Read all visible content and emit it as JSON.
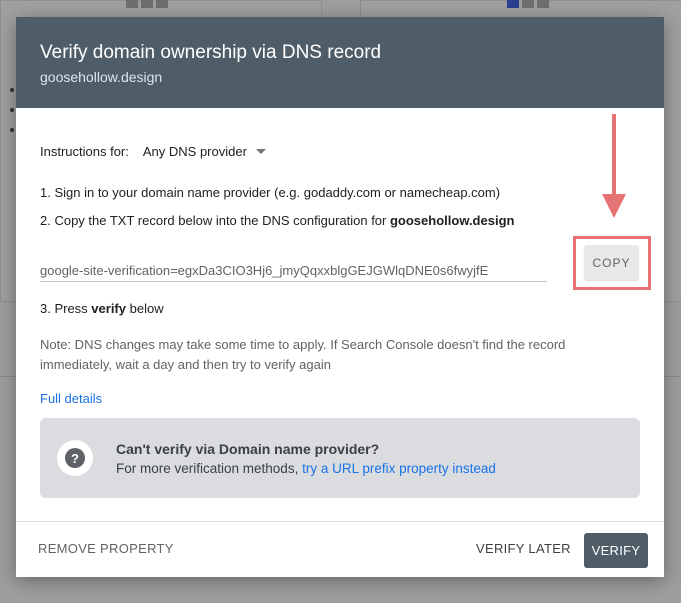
{
  "dialog": {
    "title": "Verify domain ownership via DNS record",
    "subtitle": "goosehollow.design",
    "instructions_label": "Instructions for:",
    "provider_selected": "Any DNS provider",
    "step1": "1. Sign in to your domain name provider (e.g. godaddy.com or namecheap.com)",
    "step2_prefix": "2. Copy the TXT record below into the DNS configuration for ",
    "step2_domain": "goosehollow.design",
    "txt_record": "google-site-verification=egxDa3CIO3Hj6_jmyQqxxblgGEJGWlqDNE0s6fwyjfE",
    "copy_label": "COPY",
    "step3_prefix": "3. Press ",
    "step3_bold": "verify",
    "step3_suffix": " below",
    "note": "Note: DNS changes may take some time to apply. If Search Console doesn't find the record immediately, wait a day and then try to verify again",
    "full_details": "Full details",
    "info_title": "Can't verify via Domain name provider?",
    "info_text_prefix": "For more verification methods, ",
    "info_link": "try a URL prefix property instead",
    "remove_label": "REMOVE PROPERTY",
    "verify_later_label": "VERIFY LATER",
    "verify_label": "VERIFY"
  },
  "colors": {
    "header_bg": "#4f5d68",
    "highlight": "#e57373",
    "link": "#1a73e8"
  },
  "icons": {
    "help": "question-mark-circle-icon",
    "dropdown": "caret-down-icon",
    "arrow": "arrow-down-annotation-icon"
  }
}
